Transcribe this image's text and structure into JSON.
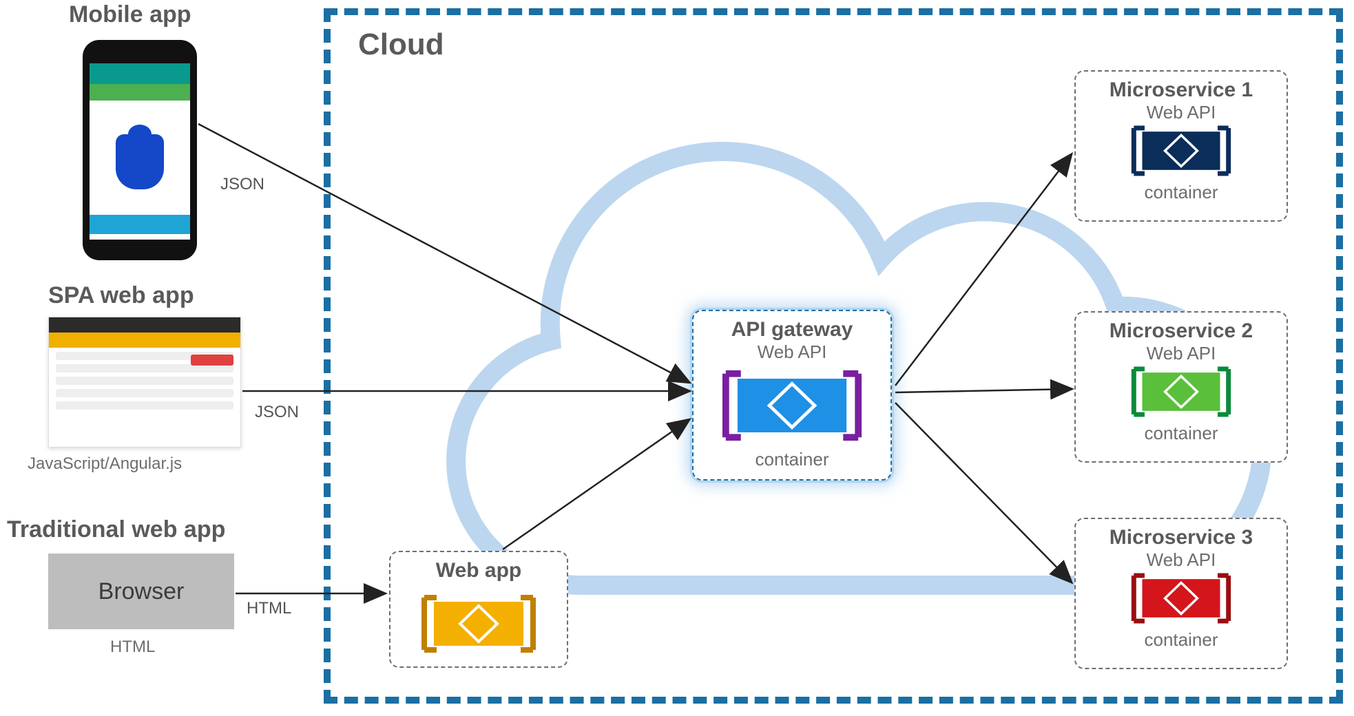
{
  "clients": {
    "mobile": {
      "title": "Mobile app",
      "proto": "JSON"
    },
    "spa": {
      "title": "SPA web app",
      "proto": "JSON",
      "sub": "JavaScript/Angular.js"
    },
    "traditional": {
      "title": "Traditional web app",
      "proto": "HTML",
      "box": "Browser",
      "sub": "HTML"
    }
  },
  "cloud_label": "Cloud",
  "nodes": {
    "webapp": {
      "title": "Web app"
    },
    "gateway": {
      "title": "API gateway",
      "api": "Web API",
      "cap": "container"
    },
    "ms1": {
      "title": "Microservice 1",
      "api": "Web API",
      "cap": "container"
    },
    "ms2": {
      "title": "Microservice 2",
      "api": "Web API",
      "cap": "container"
    },
    "ms3": {
      "title": "Microservice 3",
      "api": "Web API",
      "cap": "container"
    }
  },
  "colors": {
    "webapp": {
      "fill": "#f3b000",
      "bracket": "#c08000"
    },
    "gateway": {
      "fill": "#1e90e6",
      "bracket": "#7a1fa0"
    },
    "ms1": {
      "fill": "#0b2d5a",
      "bracket": "#0b2d5a"
    },
    "ms2": {
      "fill": "#5abf3a",
      "bracket": "#0a8a3a"
    },
    "ms3": {
      "fill": "#d4151b",
      "bracket": "#9a0e12"
    }
  }
}
